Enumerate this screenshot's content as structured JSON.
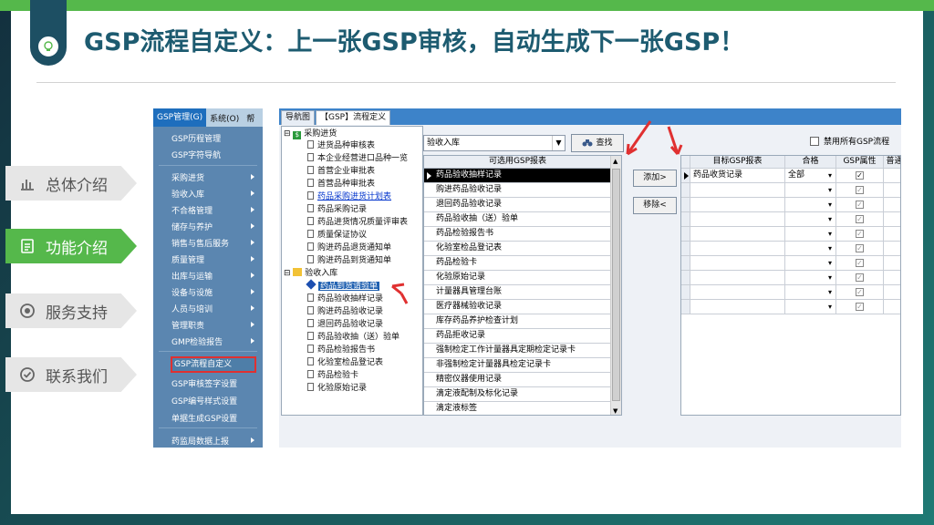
{
  "headline": "GSP流程自定义：上一张GSP审核，自动生成下一张GSP！",
  "nav": [
    {
      "label": "总体介绍",
      "icon": "bar-chart-icon",
      "active": false
    },
    {
      "label": "功能介绍",
      "icon": "document-icon",
      "active": true
    },
    {
      "label": "服务支持",
      "icon": "target-icon",
      "active": false
    },
    {
      "label": "联系我们",
      "icon": "check-circle-icon",
      "active": false
    }
  ],
  "app": {
    "menubar": [
      "GSP管理(G)",
      "系统(O)",
      "帮"
    ],
    "left_menu": [
      {
        "label": "GSP历程管理",
        "arrow": false
      },
      {
        "label": "GSP字符导航",
        "arrow": false
      },
      {
        "label": "采购进货",
        "arrow": true
      },
      {
        "label": "验收入库",
        "arrow": true
      },
      {
        "label": "不合格管理",
        "arrow": true
      },
      {
        "label": "储存与养护",
        "arrow": true
      },
      {
        "label": "销售与售后服务",
        "arrow": true
      },
      {
        "label": "质量管理",
        "arrow": true
      },
      {
        "label": "出库与运输",
        "arrow": true
      },
      {
        "label": "设备与设施",
        "arrow": true
      },
      {
        "label": "人员与培训",
        "arrow": true
      },
      {
        "label": "管理职责",
        "arrow": true
      },
      {
        "label": "GMP检验报告",
        "arrow": true
      },
      {
        "label": "GSP流程自定义",
        "arrow": false
      },
      {
        "label": "GSP审核签字设置",
        "arrow": false
      },
      {
        "label": "GSP编号样式设置",
        "arrow": false
      },
      {
        "label": "单据生成GSP设置",
        "arrow": false
      },
      {
        "label": "药监局数据上报",
        "arrow": true
      }
    ],
    "tabs": [
      "导航图",
      "【GSP】流程定义"
    ],
    "tree": {
      "group1": "采购进货",
      "group1_items": [
        "进货品种审核表",
        "本企业经营进口品种一览",
        "首营企业审批表",
        "首营品种审批表",
        "药品采购进货计划表",
        "药品采购记录",
        "药品进货情况质量评审表",
        "质量保证协议",
        "购进药品退货通知单",
        "购进药品到货通知单"
      ],
      "group2": "验收入库",
      "group2_items": [
        "药品到货请验单",
        "药品验收抽样记录",
        "购进药品验收记录",
        "退回药品验收记录",
        "药品验收抽（送）验单",
        "药品检验报告书",
        "化验室检品登记表",
        "药品检验卡",
        "化验原始记录"
      ]
    },
    "combo_value": "验收入库",
    "find_label": "查找",
    "add_label": "添加>",
    "remove_label": "移除<",
    "grid1_header": "可选用GSP报表",
    "grid1_rows": [
      "药品验收抽样记录",
      "购进药品验收记录",
      "退回药品验收记录",
      "药品验收抽（送）验单",
      "药品检验报告书",
      "化验室检品登记表",
      "药品检验卡",
      "化验原始记录",
      "计量器具管理台账",
      "医疗器械验收记录",
      "库存药品养护检查计划",
      "药品拒收记录",
      "强制检定工作计量器具定期检定记录卡",
      "非强制检定计量器具检定记录卡",
      "精密仪器使用记录",
      "滴定液配制及标化记录",
      "滴定液标签"
    ],
    "disable_all_label": "禁用所有GSP流程",
    "grid2_headers": [
      "目标GSP报表",
      "合格",
      "GSP属性",
      "普通"
    ],
    "grid2_rows": [
      {
        "report": "药品收货记录",
        "qualified": "全部"
      }
    ]
  }
}
